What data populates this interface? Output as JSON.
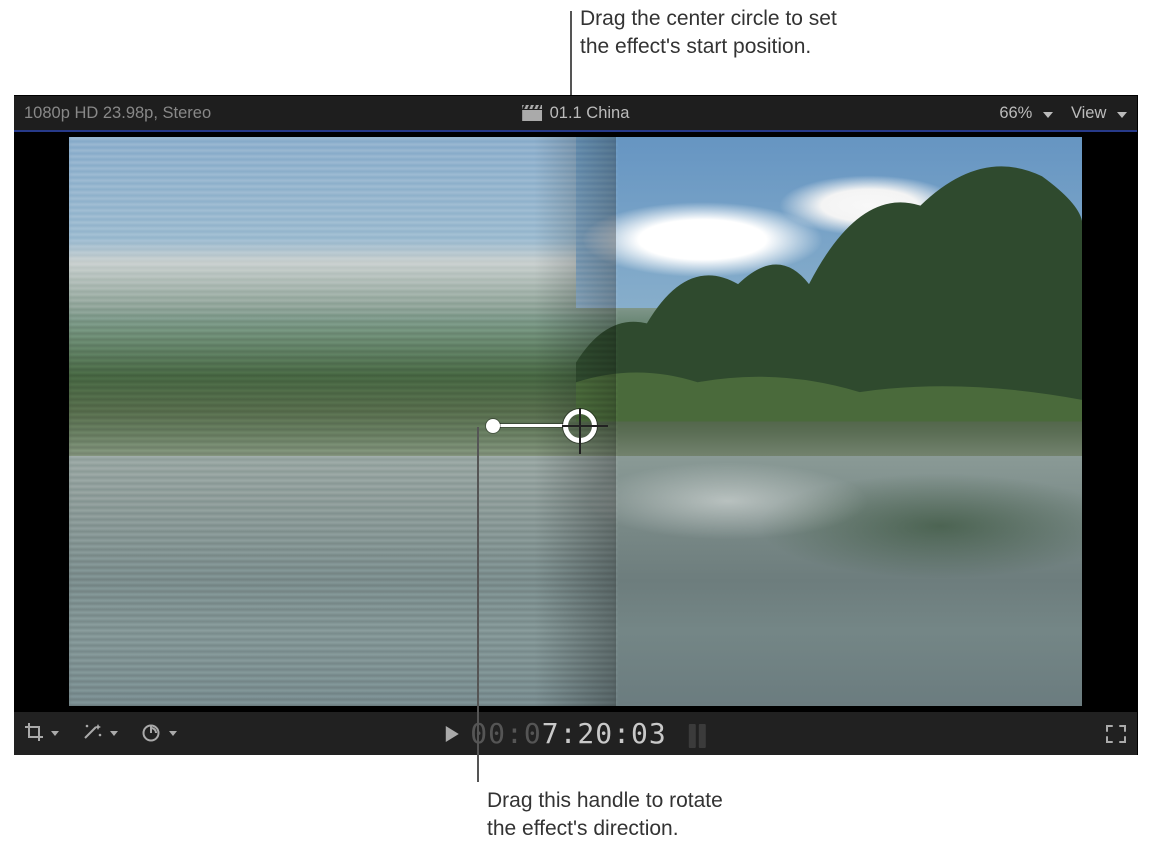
{
  "annotations": {
    "top": "Drag the center circle to set\nthe effect's start position.",
    "bottom": "Drag this handle to rotate\nthe effect's direction."
  },
  "titlebar": {
    "format": "1080p HD 23.98p, Stereo",
    "clip_name": "01.1 China",
    "zoom": "66%",
    "view_label": "View"
  },
  "toolbar": {
    "timecode_dim": "00:0",
    "timecode_bright": "7:20:03"
  },
  "icons": {
    "clapper": "clapper-icon",
    "crop": "crop-icon",
    "wand": "enhance-icon",
    "retime": "retime-icon",
    "play": "play-icon",
    "fullscreen": "fullscreen-icon",
    "chevron_down": "chevron-down-icon"
  },
  "controls": {
    "center_handle": "effect-center-handle",
    "rotate_handle": "effect-rotate-handle"
  }
}
